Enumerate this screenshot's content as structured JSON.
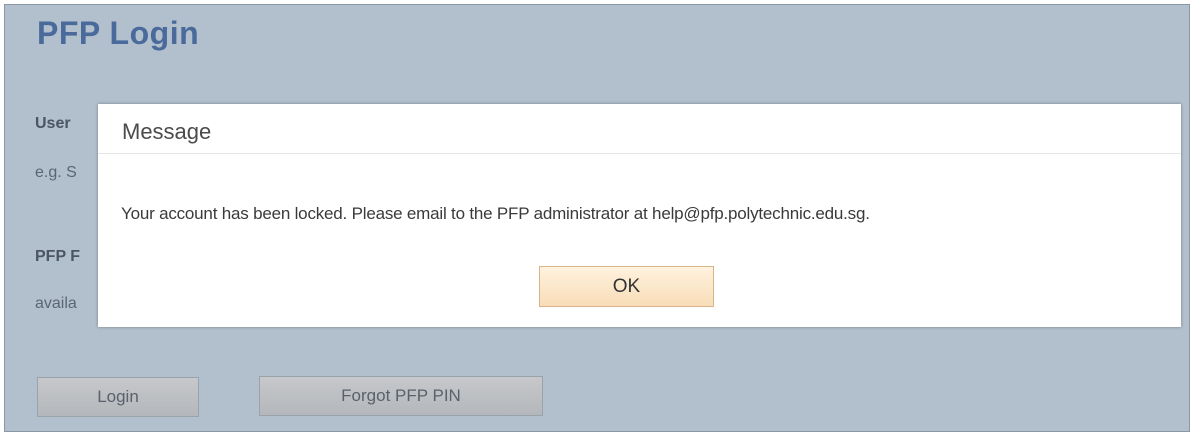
{
  "page": {
    "title": "PFP Login",
    "fragments": {
      "user_label": "User",
      "user_hint": "e.g. S",
      "pin_label": "PFP F",
      "pin_hint": "availa"
    },
    "buttons": {
      "login": "Login",
      "forgot_pin": "Forgot PFP PIN"
    }
  },
  "dialog": {
    "title": "Message",
    "message": "Your account has been locked. Please email to the PFP administrator at help@pfp.polytechnic.edu.sg.",
    "ok_label": "OK"
  },
  "colors": {
    "page_background": "#b2bfcc",
    "title_color": "#4a6a9c",
    "ok_button_fill": "#f8ddb8"
  }
}
